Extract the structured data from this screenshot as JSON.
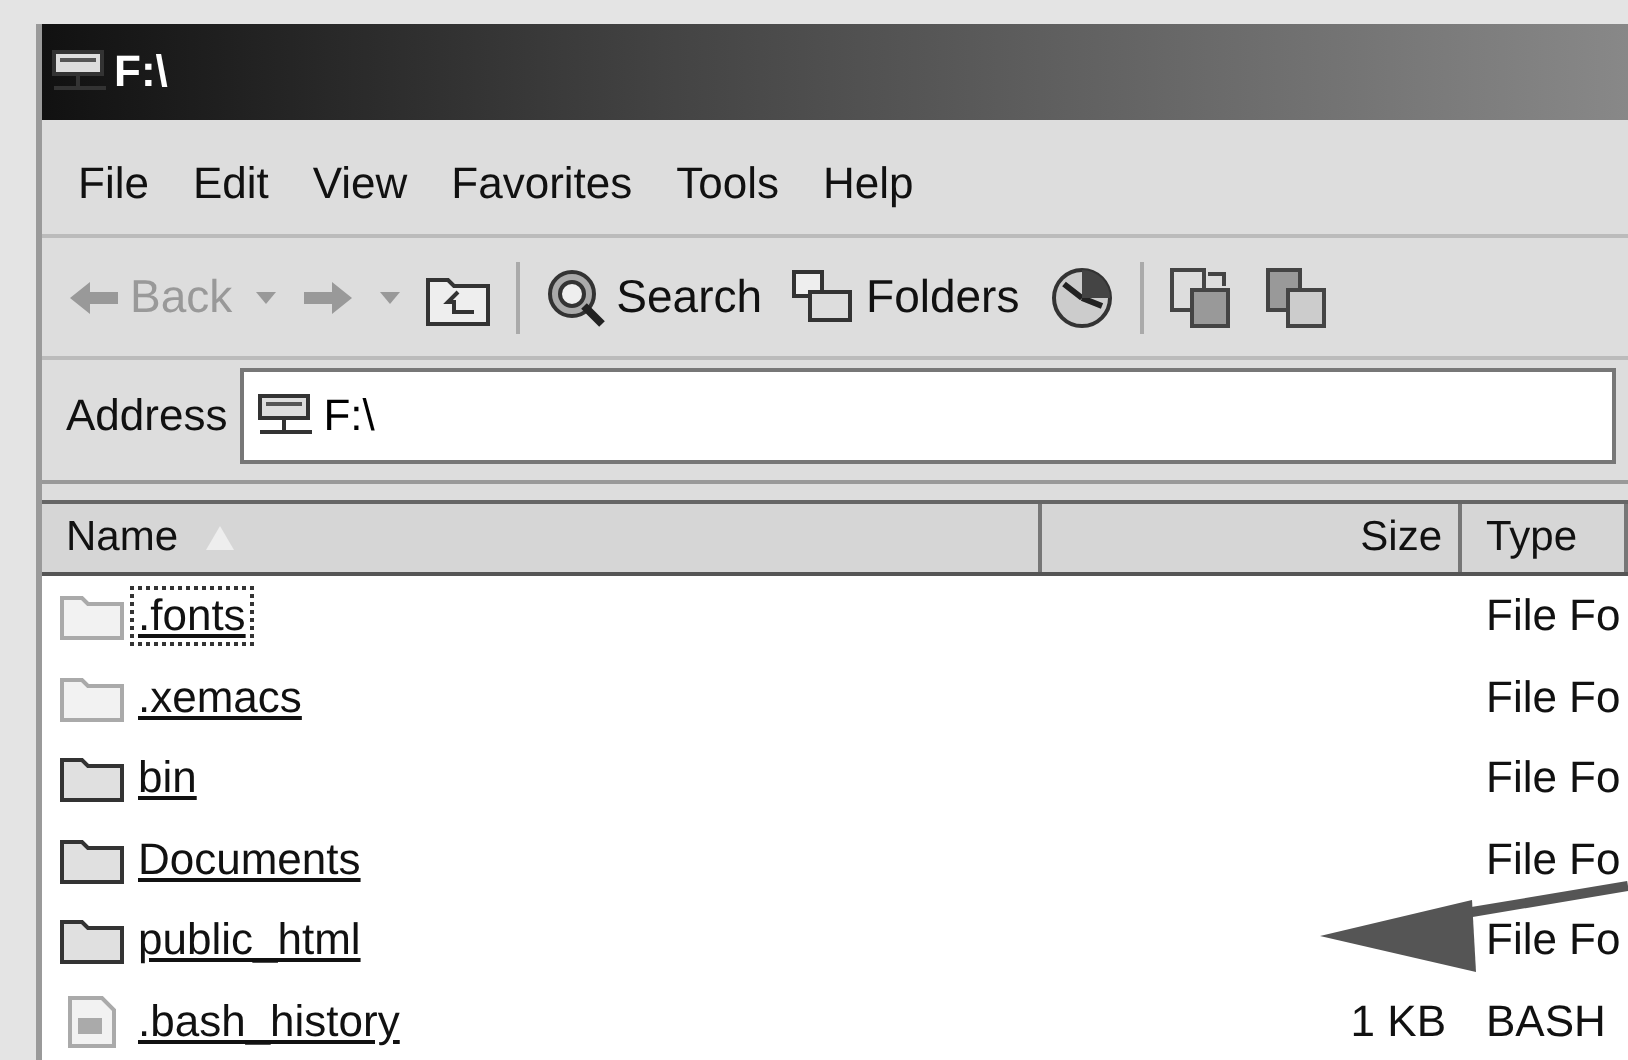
{
  "window": {
    "title": "F:\\"
  },
  "menu": [
    "File",
    "Edit",
    "View",
    "Favorites",
    "Tools",
    "Help"
  ],
  "toolbar": [
    {
      "kind": "back",
      "label": "Back",
      "disabled": true
    },
    {
      "kind": "forward",
      "disabled": true
    },
    {
      "kind": "up"
    },
    {
      "kind": "search",
      "label": "Search"
    },
    {
      "kind": "folders",
      "label": "Folders"
    },
    {
      "kind": "history"
    },
    {
      "kind": "move"
    },
    {
      "kind": "copy"
    }
  ],
  "address": {
    "label": "Address",
    "value": "F:\\"
  },
  "table": {
    "columns": [
      {
        "label": "Name",
        "sorted": true
      },
      {
        "label": "Size"
      },
      {
        "label": "Type"
      }
    ],
    "rows": [
      {
        "kind": "folder",
        "name": ".fonts",
        "size": "",
        "type": "File Fo",
        "hidden": true,
        "focused": true
      },
      {
        "kind": "folder",
        "name": ".xemacs",
        "size": "",
        "type": "File Fo",
        "hidden": true,
        "focused": false
      },
      {
        "kind": "folder",
        "name": "bin",
        "size": "",
        "type": "File Fo",
        "hidden": false,
        "focused": false
      },
      {
        "kind": "folder",
        "name": "Documents",
        "size": "",
        "type": "File Fo",
        "hidden": false,
        "focused": false
      },
      {
        "kind": "folder",
        "name": "public_html",
        "size": "",
        "type": "File Fo",
        "hidden": false,
        "focused": false
      },
      {
        "kind": "file",
        "name": ".bash_history",
        "size": "1 KB",
        "type": "BASH",
        "hidden": true,
        "focused": false
      }
    ]
  }
}
